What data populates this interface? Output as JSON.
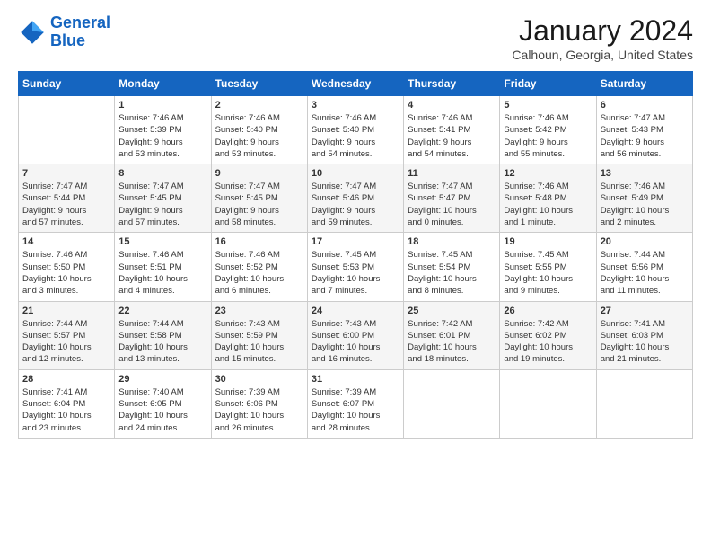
{
  "header": {
    "logo_line1": "General",
    "logo_line2": "Blue",
    "month": "January 2024",
    "location": "Calhoun, Georgia, United States"
  },
  "days_of_week": [
    "Sunday",
    "Monday",
    "Tuesday",
    "Wednesday",
    "Thursday",
    "Friday",
    "Saturday"
  ],
  "weeks": [
    [
      {
        "day": "",
        "info": ""
      },
      {
        "day": "1",
        "info": "Sunrise: 7:46 AM\nSunset: 5:39 PM\nDaylight: 9 hours\nand 53 minutes."
      },
      {
        "day": "2",
        "info": "Sunrise: 7:46 AM\nSunset: 5:40 PM\nDaylight: 9 hours\nand 53 minutes."
      },
      {
        "day": "3",
        "info": "Sunrise: 7:46 AM\nSunset: 5:40 PM\nDaylight: 9 hours\nand 54 minutes."
      },
      {
        "day": "4",
        "info": "Sunrise: 7:46 AM\nSunset: 5:41 PM\nDaylight: 9 hours\nand 54 minutes."
      },
      {
        "day": "5",
        "info": "Sunrise: 7:46 AM\nSunset: 5:42 PM\nDaylight: 9 hours\nand 55 minutes."
      },
      {
        "day": "6",
        "info": "Sunrise: 7:47 AM\nSunset: 5:43 PM\nDaylight: 9 hours\nand 56 minutes."
      }
    ],
    [
      {
        "day": "7",
        "info": "Sunrise: 7:47 AM\nSunset: 5:44 PM\nDaylight: 9 hours\nand 57 minutes."
      },
      {
        "day": "8",
        "info": "Sunrise: 7:47 AM\nSunset: 5:45 PM\nDaylight: 9 hours\nand 57 minutes."
      },
      {
        "day": "9",
        "info": "Sunrise: 7:47 AM\nSunset: 5:45 PM\nDaylight: 9 hours\nand 58 minutes."
      },
      {
        "day": "10",
        "info": "Sunrise: 7:47 AM\nSunset: 5:46 PM\nDaylight: 9 hours\nand 59 minutes."
      },
      {
        "day": "11",
        "info": "Sunrise: 7:47 AM\nSunset: 5:47 PM\nDaylight: 10 hours\nand 0 minutes."
      },
      {
        "day": "12",
        "info": "Sunrise: 7:46 AM\nSunset: 5:48 PM\nDaylight: 10 hours\nand 1 minute."
      },
      {
        "day": "13",
        "info": "Sunrise: 7:46 AM\nSunset: 5:49 PM\nDaylight: 10 hours\nand 2 minutes."
      }
    ],
    [
      {
        "day": "14",
        "info": "Sunrise: 7:46 AM\nSunset: 5:50 PM\nDaylight: 10 hours\nand 3 minutes."
      },
      {
        "day": "15",
        "info": "Sunrise: 7:46 AM\nSunset: 5:51 PM\nDaylight: 10 hours\nand 4 minutes."
      },
      {
        "day": "16",
        "info": "Sunrise: 7:46 AM\nSunset: 5:52 PM\nDaylight: 10 hours\nand 6 minutes."
      },
      {
        "day": "17",
        "info": "Sunrise: 7:45 AM\nSunset: 5:53 PM\nDaylight: 10 hours\nand 7 minutes."
      },
      {
        "day": "18",
        "info": "Sunrise: 7:45 AM\nSunset: 5:54 PM\nDaylight: 10 hours\nand 8 minutes."
      },
      {
        "day": "19",
        "info": "Sunrise: 7:45 AM\nSunset: 5:55 PM\nDaylight: 10 hours\nand 9 minutes."
      },
      {
        "day": "20",
        "info": "Sunrise: 7:44 AM\nSunset: 5:56 PM\nDaylight: 10 hours\nand 11 minutes."
      }
    ],
    [
      {
        "day": "21",
        "info": "Sunrise: 7:44 AM\nSunset: 5:57 PM\nDaylight: 10 hours\nand 12 minutes."
      },
      {
        "day": "22",
        "info": "Sunrise: 7:44 AM\nSunset: 5:58 PM\nDaylight: 10 hours\nand 13 minutes."
      },
      {
        "day": "23",
        "info": "Sunrise: 7:43 AM\nSunset: 5:59 PM\nDaylight: 10 hours\nand 15 minutes."
      },
      {
        "day": "24",
        "info": "Sunrise: 7:43 AM\nSunset: 6:00 PM\nDaylight: 10 hours\nand 16 minutes."
      },
      {
        "day": "25",
        "info": "Sunrise: 7:42 AM\nSunset: 6:01 PM\nDaylight: 10 hours\nand 18 minutes."
      },
      {
        "day": "26",
        "info": "Sunrise: 7:42 AM\nSunset: 6:02 PM\nDaylight: 10 hours\nand 19 minutes."
      },
      {
        "day": "27",
        "info": "Sunrise: 7:41 AM\nSunset: 6:03 PM\nDaylight: 10 hours\nand 21 minutes."
      }
    ],
    [
      {
        "day": "28",
        "info": "Sunrise: 7:41 AM\nSunset: 6:04 PM\nDaylight: 10 hours\nand 23 minutes."
      },
      {
        "day": "29",
        "info": "Sunrise: 7:40 AM\nSunset: 6:05 PM\nDaylight: 10 hours\nand 24 minutes."
      },
      {
        "day": "30",
        "info": "Sunrise: 7:39 AM\nSunset: 6:06 PM\nDaylight: 10 hours\nand 26 minutes."
      },
      {
        "day": "31",
        "info": "Sunrise: 7:39 AM\nSunset: 6:07 PM\nDaylight: 10 hours\nand 28 minutes."
      },
      {
        "day": "",
        "info": ""
      },
      {
        "day": "",
        "info": ""
      },
      {
        "day": "",
        "info": ""
      }
    ]
  ]
}
